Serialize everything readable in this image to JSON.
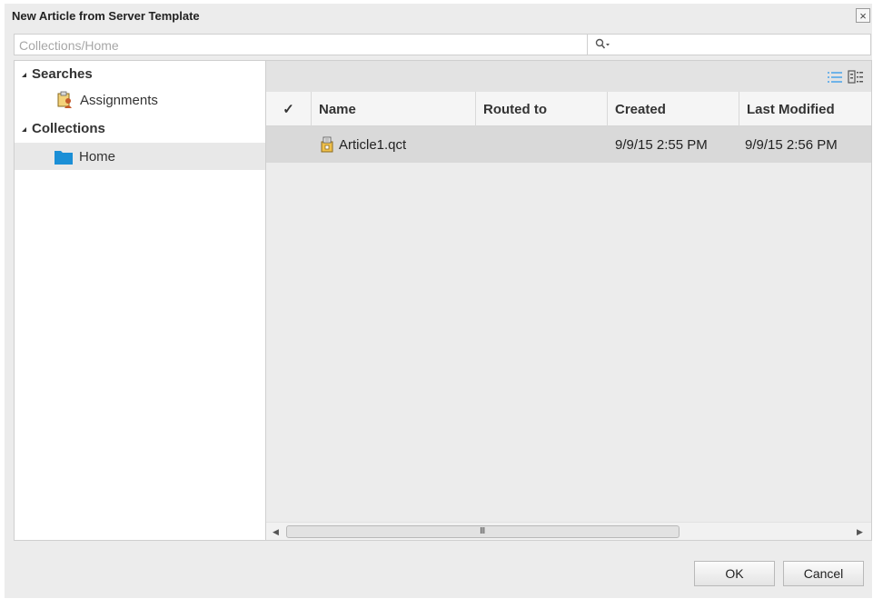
{
  "window": {
    "title": "New Article from Server Template",
    "close_symbol": "×"
  },
  "pathbar": {
    "placeholder": "Collections/Home"
  },
  "search": {
    "value": ""
  },
  "tree": {
    "searches_label": "Searches",
    "assignments_label": "Assignments",
    "collections_label": "Collections",
    "home_label": "Home"
  },
  "table": {
    "headers": {
      "check": "✓",
      "name": "Name",
      "routed_to": "Routed to",
      "created": "Created",
      "last_modified": "Last Modified"
    },
    "rows": [
      {
        "name": "Article1.qct",
        "routed_to": "",
        "created": "9/9/15 2:55 PM",
        "last_modified": "9/9/15 2:56 PM"
      }
    ]
  },
  "scrollbar": {
    "left_arrow": "◀",
    "right_arrow": "▶",
    "grip": "III"
  },
  "buttons": {
    "ok": "OK",
    "cancel": "Cancel"
  },
  "icons": {
    "list_view": "list-view-icon",
    "detail_view": "detail-view-icon",
    "assignments": "assignments-icon",
    "folder": "folder-icon",
    "file": "qct-file-icon"
  },
  "colors": {
    "folder": "#1b8fd6",
    "selected_row": "#d9d9d9",
    "list_view_icon": "#6fb3e8"
  }
}
